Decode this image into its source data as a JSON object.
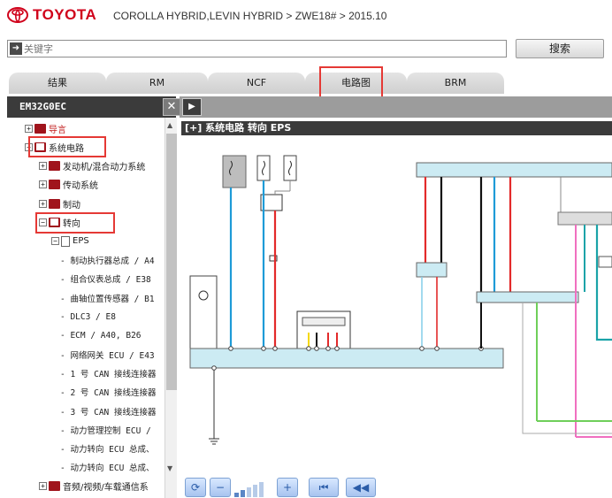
{
  "header": {
    "brand": "TOYOTA",
    "breadcrumb": "COROLLA HYBRID,LEVIN HYBRID > ZWE18# > 2015.10"
  },
  "search": {
    "placeholder": "关键字",
    "button_label": "搜索"
  },
  "tabs": [
    {
      "label": "结果"
    },
    {
      "label": "RM"
    },
    {
      "label": "NCF"
    },
    {
      "label": "电路图",
      "highlighted": true
    },
    {
      "label": "BRM"
    }
  ],
  "left_panel": {
    "title": "EM32G0EC",
    "close_label": "✕",
    "tree": [
      {
        "label": "导言",
        "level": 1,
        "kind": "book",
        "expander": "+"
      },
      {
        "label": "系统电路",
        "level": 1,
        "kind": "book-open",
        "expander": "−"
      },
      {
        "label": "发动机/混合动力系统",
        "level": 2,
        "kind": "book",
        "expander": "+"
      },
      {
        "label": "传动系统",
        "level": 2,
        "kind": "book",
        "expander": "+"
      },
      {
        "label": "制动",
        "level": 2,
        "kind": "book",
        "expander": "+"
      },
      {
        "label": "转向",
        "level": 2,
        "kind": "book-open",
        "expander": "−"
      },
      {
        "label": "EPS",
        "level": 3,
        "kind": "page",
        "expander": "−"
      },
      {
        "label": "- 制动执行器总成 / A4",
        "level": 4,
        "kind": "leaf"
      },
      {
        "label": "- 组合仪表总成 / E38",
        "level": 4,
        "kind": "leaf"
      },
      {
        "label": "- 曲轴位置传感器 / B1",
        "level": 4,
        "kind": "leaf"
      },
      {
        "label": "- DLC3 / E8",
        "level": 4,
        "kind": "leaf"
      },
      {
        "label": "- ECM / A40, B26",
        "level": 4,
        "kind": "leaf"
      },
      {
        "label": "- 网络网关 ECU / E43",
        "level": 4,
        "kind": "leaf"
      },
      {
        "label": "- 1 号 CAN 接线连接器",
        "level": 4,
        "kind": "leaf"
      },
      {
        "label": "- 2 号 CAN 接线连接器",
        "level": 4,
        "kind": "leaf"
      },
      {
        "label": "- 3 号 CAN 接线连接器",
        "level": 4,
        "kind": "leaf"
      },
      {
        "label": "- 动力管理控制 ECU /",
        "level": 4,
        "kind": "leaf"
      },
      {
        "label": "- 动力转向 ECU 总成、",
        "level": 4,
        "kind": "leaf"
      },
      {
        "label": "- 动力转向 ECU 总成、",
        "level": 4,
        "kind": "leaf"
      },
      {
        "label": "音频/视频/车载通信系",
        "level": 2,
        "kind": "book",
        "expander": "+"
      }
    ]
  },
  "diagram": {
    "title": "系统电路  转向  EPS",
    "title_prefix": "[+]"
  },
  "bottom_bar": {
    "buttons": [
      "refresh",
      "zoom-out",
      "zoom-in",
      "first-page",
      "previous-page"
    ]
  },
  "colors": {
    "brand_red": "#d0021b",
    "highlight_red": "#e53935",
    "panel_dark": "#3b3b3b",
    "wire_blue": "#1e9bd7",
    "wire_red": "#e32a2a",
    "wire_black": "#111111",
    "wire_pink": "#f06fc0",
    "wire_green": "#6fcf5a",
    "wire_yellow": "#f5d90a",
    "wire_teal": "#1aa3a8"
  }
}
